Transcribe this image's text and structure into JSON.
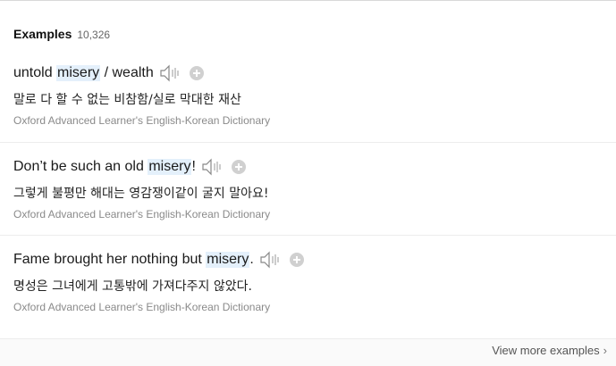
{
  "section": {
    "title": "Examples",
    "count": "10,326"
  },
  "examples": [
    {
      "pre": "untold ",
      "highlight": "misery",
      "post": " / wealth",
      "translation": "말로 다 할 수 없는 비참함/실로 막대한 재산",
      "source": "Oxford Advanced Learner's English-Korean Dictionary"
    },
    {
      "pre": "Don’t be such an old ",
      "highlight": "misery",
      "post": "!",
      "translation": "그렇게 불평만 해대는 영감쟁이같이 굴지 말아요!",
      "source": "Oxford Advanced Learner's English-Korean Dictionary"
    },
    {
      "pre": "Fame brought her nothing but ",
      "highlight": "misery",
      "post": ".",
      "translation": "명성은 그녀에게 고통밖에 가져다주지 않았다.",
      "source": "Oxford Advanced Learner's English-Korean Dictionary"
    }
  ],
  "footer": {
    "more_label": "View more examples",
    "chevron": "›"
  },
  "icons": {
    "speaker": "speaker-icon",
    "add": "add-circle-icon"
  },
  "colors": {
    "highlight": "#e4f0fb",
    "source_text": "#8a8a8a"
  }
}
